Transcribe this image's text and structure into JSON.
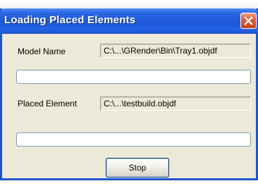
{
  "window": {
    "title": "Loading Placed Elements"
  },
  "model": {
    "label": "Model Name",
    "path": "C:\\...\\GRender\\Bin\\Tray1.objdf",
    "progress": 0
  },
  "placed": {
    "label": "Placed Element",
    "path": "C:\\...\\testbuild.objdf",
    "progress": 0
  },
  "buttons": {
    "stop_label": "Stop"
  },
  "icons": {
    "close": "close-icon"
  },
  "colors": {
    "titlebar": "#1e59d9",
    "close_button": "#e45a2a",
    "dialog_body": "#ece9d8"
  }
}
